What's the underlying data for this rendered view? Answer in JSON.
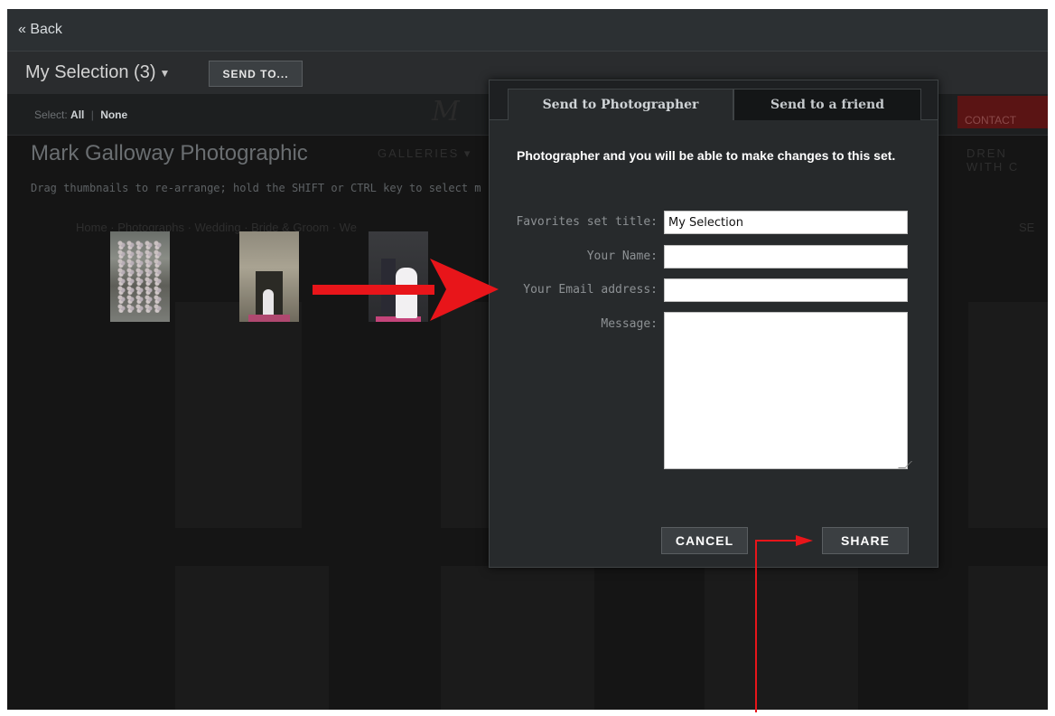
{
  "topbar": {
    "back_label": "« Back"
  },
  "selection": {
    "title": "My Selection (3)",
    "caret": "▼",
    "send_to_label": "SEND TO..."
  },
  "select_bar": {
    "prefix": "Select:",
    "all_label": "All",
    "separator": "|",
    "none_label": "None"
  },
  "background": {
    "site_title": "Mark Galloway Photographic",
    "nav_galleries": "GALLERIES ▾",
    "nav_right": "DREN  WITH C",
    "hint": "Drag thumbnails to re-arrange; hold the SHIFT or CTRL key to select m",
    "breadcrumb": "Home · Photographs · Wedding · Bride & Groom · We",
    "right_fragment": "SE",
    "contact_label": "CONTACT"
  },
  "dialog": {
    "tabs": [
      "Send to Photographer",
      "Send to a friend"
    ],
    "description": "Photographer and you will be able to make changes to this set.",
    "fields": {
      "title_label": "Favorites set title:",
      "title_value": "My Selection",
      "name_label": "Your Name:",
      "name_value": "",
      "email_label": "Your Email address:",
      "email_value": "",
      "message_label": "Message:",
      "message_value": ""
    },
    "cancel_label": "CANCEL",
    "share_label": "SHARE"
  },
  "colors": {
    "accent_red": "#e8151a",
    "dialog_bg": "#272a2c",
    "page_bg": "#151515"
  }
}
